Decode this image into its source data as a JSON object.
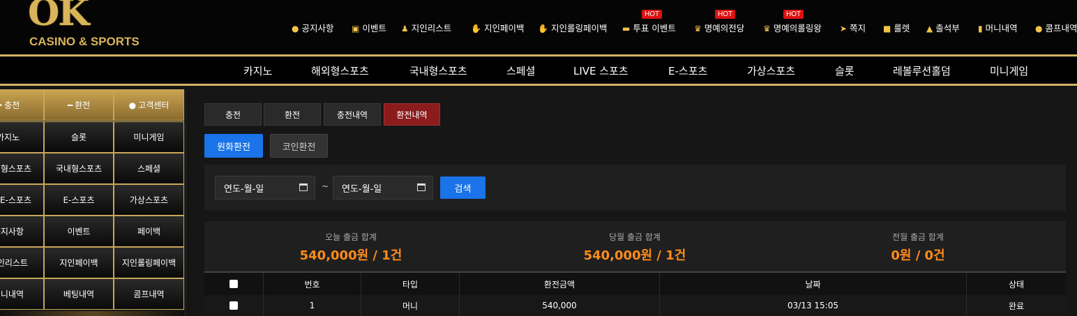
{
  "logo": {
    "main": "OK",
    "sub": "CASINO & SPORTS"
  },
  "top_menu": [
    {
      "label": "공지사항",
      "icon": "exclamation-icon",
      "hot": false
    },
    {
      "label": "이벤트",
      "icon": "calendar-check-icon",
      "hot": false
    },
    {
      "label": "지인리스트",
      "icon": "users-icon",
      "hot": false
    },
    {
      "label": "지인페이백",
      "icon": "hand-coin-icon",
      "hot": false
    },
    {
      "label": "지인롤링페이백",
      "icon": "hand-coin-icon",
      "hot": false
    },
    {
      "label": "투표 이벤트",
      "icon": "vote-icon",
      "hot": true
    },
    {
      "label": "명예의전당",
      "icon": "trophy-icon",
      "hot": true
    },
    {
      "label": "명예의롤링왕",
      "icon": "trophy-icon",
      "hot": true
    },
    {
      "label": "쪽지",
      "icon": "paper-plane-icon",
      "hot": false
    },
    {
      "label": "룰렛",
      "icon": "gift-icon",
      "hot": false
    },
    {
      "label": "출석부",
      "icon": "stamp-icon",
      "hot": false
    },
    {
      "label": "머니내역",
      "icon": "clipboard-icon",
      "hot": false
    },
    {
      "label": "콤프내역",
      "icon": "piggy-bank-icon",
      "hot": false
    }
  ],
  "hot_label": "HOT",
  "main_nav": [
    "카지노",
    "해외형스포츠",
    "국내형스포츠",
    "스페셜",
    "LIVE 스포츠",
    "E-스포츠",
    "가상스포츠",
    "슬롯",
    "레볼루션홀덤",
    "미니게임"
  ],
  "sidebar": {
    "header": [
      {
        "label": "충전",
        "icon": "plus-icon"
      },
      {
        "label": "환전",
        "icon": "minus-icon"
      },
      {
        "label": "고객센터",
        "icon": "exclamation-icon"
      }
    ],
    "rows": [
      [
        "카지노",
        "슬롯",
        "미니게임"
      ],
      [
        "해외형스포츠",
        "국내형스포츠",
        "스페셜"
      ],
      [
        "LIVE E-스포츠",
        "E-스포츠",
        "가상스포츠"
      ],
      [
        "공지사항",
        "이벤트",
        "페이백"
      ],
      [
        "지인리스트",
        "지인페이백",
        "지인롤링페이백"
      ],
      [
        "머니내역",
        "베팅내역",
        "콤프내역"
      ]
    ]
  },
  "tabs": [
    "충전",
    "환전",
    "충전내역",
    "환전내역"
  ],
  "active_tab": "환전내역",
  "subtabs": [
    "원화환전",
    "코인환전"
  ],
  "filter": {
    "start_placeholder": "연도-월-일",
    "end_placeholder": "연도-월-일",
    "separator": "~",
    "search_label": "검색"
  },
  "summary": [
    {
      "label": "오늘 출금 합계",
      "value": "540,000원 / 1건"
    },
    {
      "label": "당월 출금 합계",
      "value": "540,000원 / 1건"
    },
    {
      "label": "전월 출금 합계",
      "value": "0원 / 0건"
    }
  ],
  "table": {
    "columns": [
      "",
      "번호",
      "타입",
      "환전금액",
      "날짜",
      "상태"
    ],
    "rows": [
      [
        "",
        "1",
        "머니",
        "540,000",
        "03/13 15:05",
        "완료"
      ]
    ]
  },
  "colors": {
    "gold": "#d6b466",
    "accent_blue": "#1a73e8",
    "active_red": "#8c1c1c",
    "amount_orange": "#ff8c1a",
    "hot_red": "#dd1111"
  }
}
